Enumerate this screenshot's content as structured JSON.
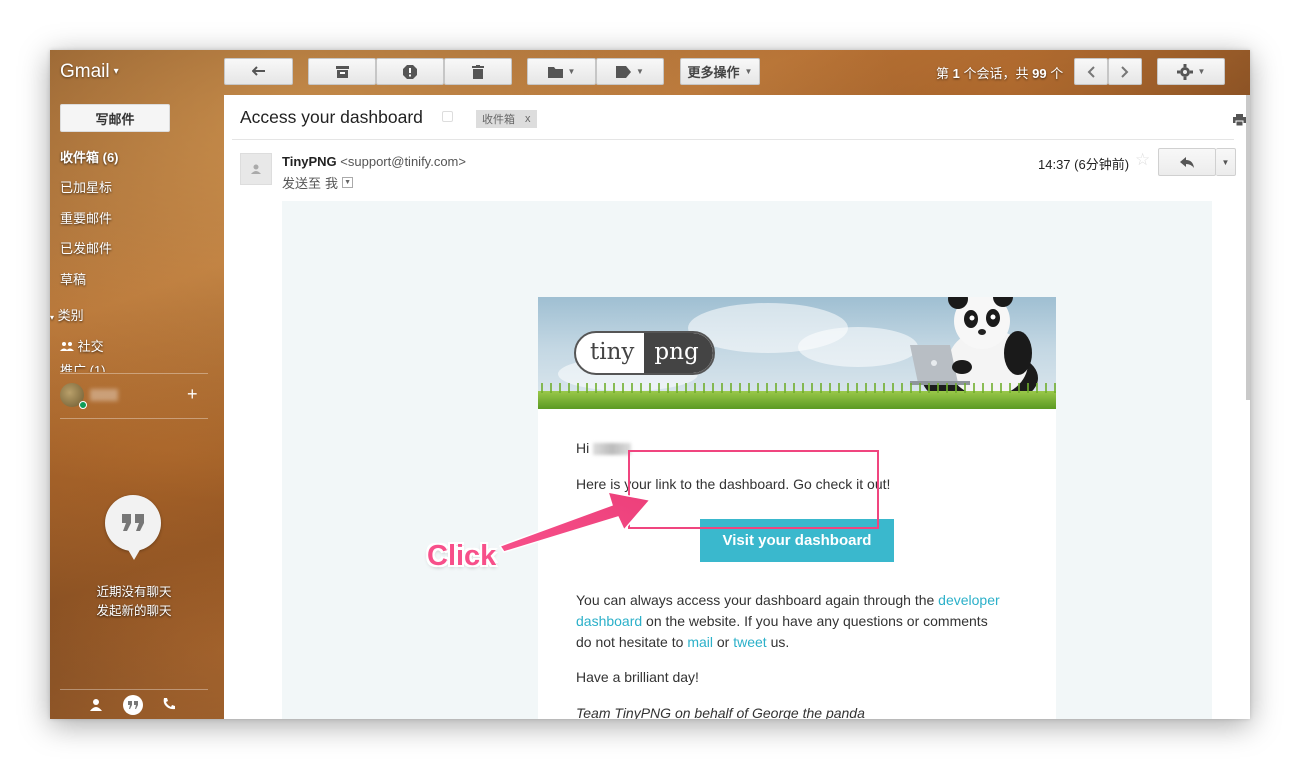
{
  "app": {
    "name": "Gmail"
  },
  "toolbar": {
    "more_actions": "更多操作",
    "pager_prefix": "第",
    "pager_current": "1",
    "pager_mid": "个会话，共",
    "pager_total": "99",
    "pager_suffix": "个"
  },
  "sidebar": {
    "compose": "写邮件",
    "items": [
      {
        "label": "收件箱 (6)",
        "bold": true
      },
      {
        "label": "已加星标"
      },
      {
        "label": "重要邮件"
      },
      {
        "label": "已发邮件"
      },
      {
        "label": "草稿"
      }
    ],
    "categories": "类别",
    "social": "社交",
    "promotions_partial": "推广 (1)",
    "hangouts_line1": "近期没有聊天",
    "hangouts_line2": "发起新的聊天"
  },
  "email": {
    "subject": "Access your dashboard",
    "label": "收件箱",
    "label_remove": "x",
    "sender_name": "TinyPNG",
    "sender_address": "<support@tinify.com>",
    "to_prefix": "发送至",
    "to": "我",
    "time": "14:37 (6分钟前)",
    "logo_left": "tiny",
    "logo_right": "png",
    "greeting": "Hi",
    "line1": "Here is your link to the dashboard. Go check it out!",
    "button": "Visit your dashboard",
    "p2_a": "You can always access your dashboard again through the ",
    "p2_link1a": "developer",
    "p2_link1b": "dashboard",
    "p2_b": " on the website. If you have any questions or comments",
    "p2_c": "do not hesitate to ",
    "p2_link2": "mail",
    "p2_or": " or ",
    "p2_link3": "tweet",
    "p2_end": " us.",
    "closing": "Have a brilliant day!",
    "signature": "Team TinyPNG on behalf of George the panda"
  },
  "annotation": {
    "label": "Click"
  },
  "colors": {
    "accent": "#3ab8cd",
    "highlight": "#f0457f",
    "link": "#2bb0c9"
  }
}
